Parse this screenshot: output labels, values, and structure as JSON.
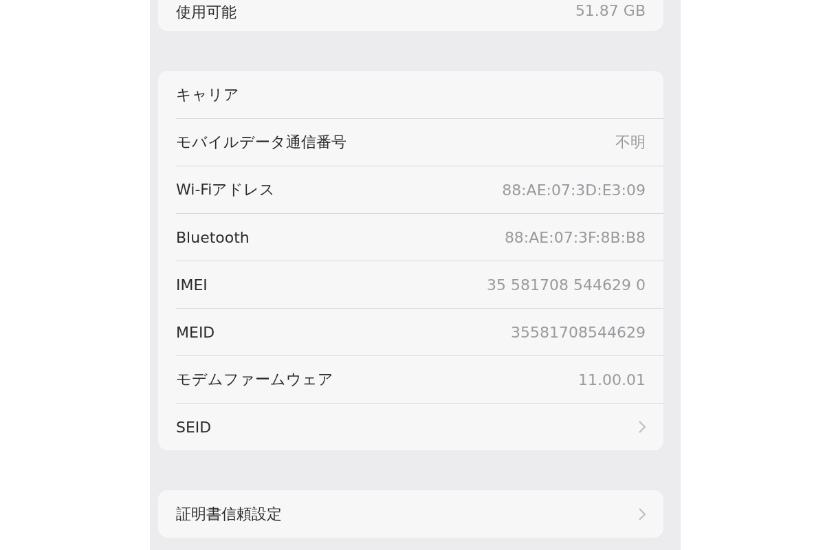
{
  "groups": [
    {
      "rows": [
        {
          "kind": "value",
          "label": "使用可能",
          "value": "51.87 GB"
        }
      ]
    },
    {
      "rows": [
        {
          "kind": "plain",
          "label": "キャリア"
        },
        {
          "kind": "value",
          "label": "モバイルデータ通信番号",
          "value": "不明"
        },
        {
          "kind": "value",
          "label": "Wi-Fiアドレス",
          "value": "88:AE:07:3D:E3:09"
        },
        {
          "kind": "value",
          "label": "Bluetooth",
          "value": "88:AE:07:3F:8B:B8"
        },
        {
          "kind": "value",
          "label": "IMEI",
          "value": "35 581708 544629 0"
        },
        {
          "kind": "value",
          "label": "MEID",
          "value": "35581708544629"
        },
        {
          "kind": "value",
          "label": "モデムファームウェア",
          "value": "11.00.01"
        },
        {
          "kind": "link",
          "label": "SEID"
        }
      ]
    },
    {
      "rows": [
        {
          "kind": "link",
          "label": "証明書信頼設定"
        }
      ]
    }
  ]
}
